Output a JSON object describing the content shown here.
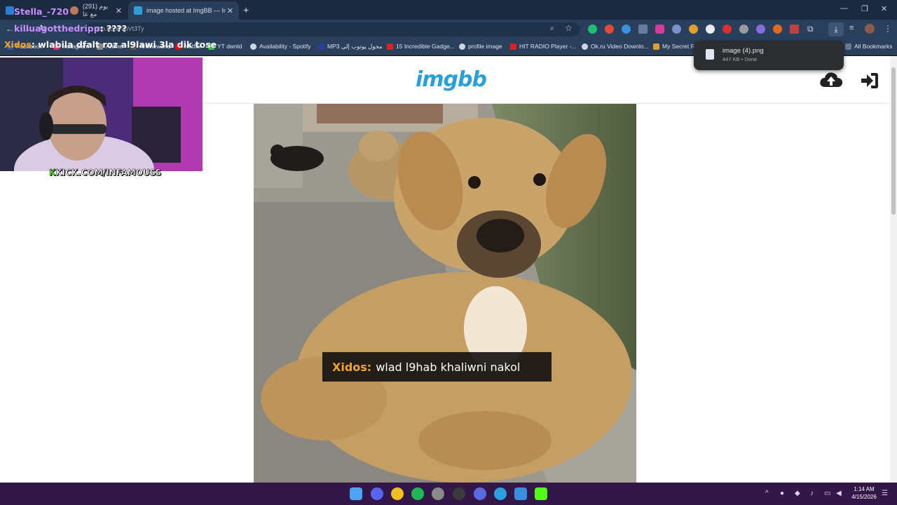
{
  "tabs": [
    {
      "title": "Stella_-720",
      "active": false
    },
    {
      "title": "(291) يوم مع عا",
      "active": false
    },
    {
      "title": "image hosted at ImgBB — ImgB",
      "active": true
    }
  ],
  "toolbar": {
    "url": "ibb.co/WvpVt3Ty"
  },
  "bookmarks": [
    {
      "label": "Facebook"
    },
    {
      "label": "Instagram"
    },
    {
      "label": "Anime"
    },
    {
      "label": "Animeworld"
    },
    {
      "label": "Netflix"
    },
    {
      "label": "YT dwnld"
    },
    {
      "label": "Availability - Spotify"
    },
    {
      "label": "MP3 محول يوتوب إلى"
    },
    {
      "label": "15 Incredible Gadge..."
    },
    {
      "label": "profile image"
    },
    {
      "label": "HIT RADIO Player -..."
    },
    {
      "label": "Ok.ru Video Downlo..."
    },
    {
      "label": "My Secret Re..."
    },
    {
      "label": "All Bookmarks"
    }
  ],
  "download": {
    "filename": "image (4).png",
    "meta": "447 KB • Done"
  },
  "site": {
    "logo": "imgbb"
  },
  "stream": {
    "kick_prefix": "K",
    "kick_text": "KICK.COM/INFAMOUSS",
    "chat": [
      {
        "user": "Stella_-720",
        "color": "#c88cff"
      },
      {
        "user": "killuagotthedripp",
        "msg": ": ????",
        "color": "#c88cff"
      },
      {
        "user": "Xidos",
        "msg": ": wlabila dfalt roz al9lawi 3la dik tose",
        "color": "#f5a623"
      }
    ],
    "caption": {
      "user": "Xidos:",
      "msg": "wlad l9hab khaliwni nakol"
    }
  },
  "taskbar": {
    "time": "1:14 AM",
    "date": "4/15/2026"
  },
  "colors": {
    "accent": "#2a9fd8",
    "taskbar": "#321748",
    "chrome": "#2a3f5c"
  }
}
